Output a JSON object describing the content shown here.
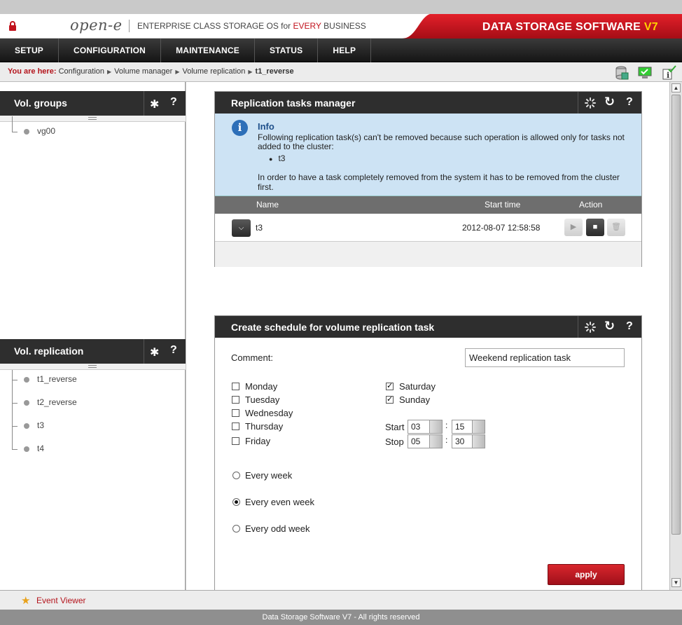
{
  "header": {
    "logo": "open-e",
    "tagline_prefix": "ENTERPRISE CLASS STORAGE OS for ",
    "tagline_highlight": "EVERY",
    "tagline_suffix": " BUSINESS",
    "brand_prefix": "DATA STORAGE SOFTWARE ",
    "brand_version": "V7",
    "brand_color": "#c1121c"
  },
  "menu": [
    "SETUP",
    "CONFIGURATION",
    "MAINTENANCE",
    "STATUS",
    "HELP"
  ],
  "breadcrumb": {
    "prefix": "You are here:",
    "items": [
      "Configuration",
      "Volume manager",
      "Volume replication"
    ],
    "current": "t1_reverse"
  },
  "vol_groups": {
    "title": "Vol. groups",
    "items": [
      "vg00"
    ]
  },
  "vol_replication": {
    "title": "Vol. replication",
    "items": [
      "t1_reverse",
      "t2_reverse",
      "t3",
      "t4"
    ]
  },
  "tasks_manager": {
    "title": "Replication tasks manager",
    "info_title": "Info",
    "info_text": "Following replication task(s) can't be removed because such operation is allowed only for tasks not added to the cluster:",
    "info_item": "t3",
    "info_text2": "In order to have a task completely removed from the system it has to be removed from the cluster first.",
    "columns": [
      "Name",
      "Start time",
      "Action"
    ],
    "rows": [
      {
        "name": "t3",
        "start_time": "2012-08-07 12:58:58"
      }
    ]
  },
  "schedule": {
    "title": "Create schedule for volume replication task",
    "comment_label": "Comment:",
    "comment_value": "Weekend replication task",
    "days": [
      {
        "label": "Monday",
        "checked": false
      },
      {
        "label": "Tuesday",
        "checked": false
      },
      {
        "label": "Wednesday",
        "checked": false
      },
      {
        "label": "Thursday",
        "checked": false
      },
      {
        "label": "Friday",
        "checked": false
      },
      {
        "label": "Saturday",
        "checked": true
      },
      {
        "label": "Sunday",
        "checked": true
      }
    ],
    "start_label": "Start",
    "start_hour": "03",
    "start_min": "15",
    "stop_label": "Stop",
    "stop_hour": "05",
    "stop_min": "30",
    "time_separator": ":",
    "frequency": [
      {
        "label": "Every week",
        "selected": false
      },
      {
        "label": "Every even week",
        "selected": true
      },
      {
        "label": "Every odd week",
        "selected": false
      }
    ],
    "apply_label": "apply"
  },
  "event_viewer": "Event Viewer",
  "footer": "Data Storage Software V7 - All rights reserved"
}
